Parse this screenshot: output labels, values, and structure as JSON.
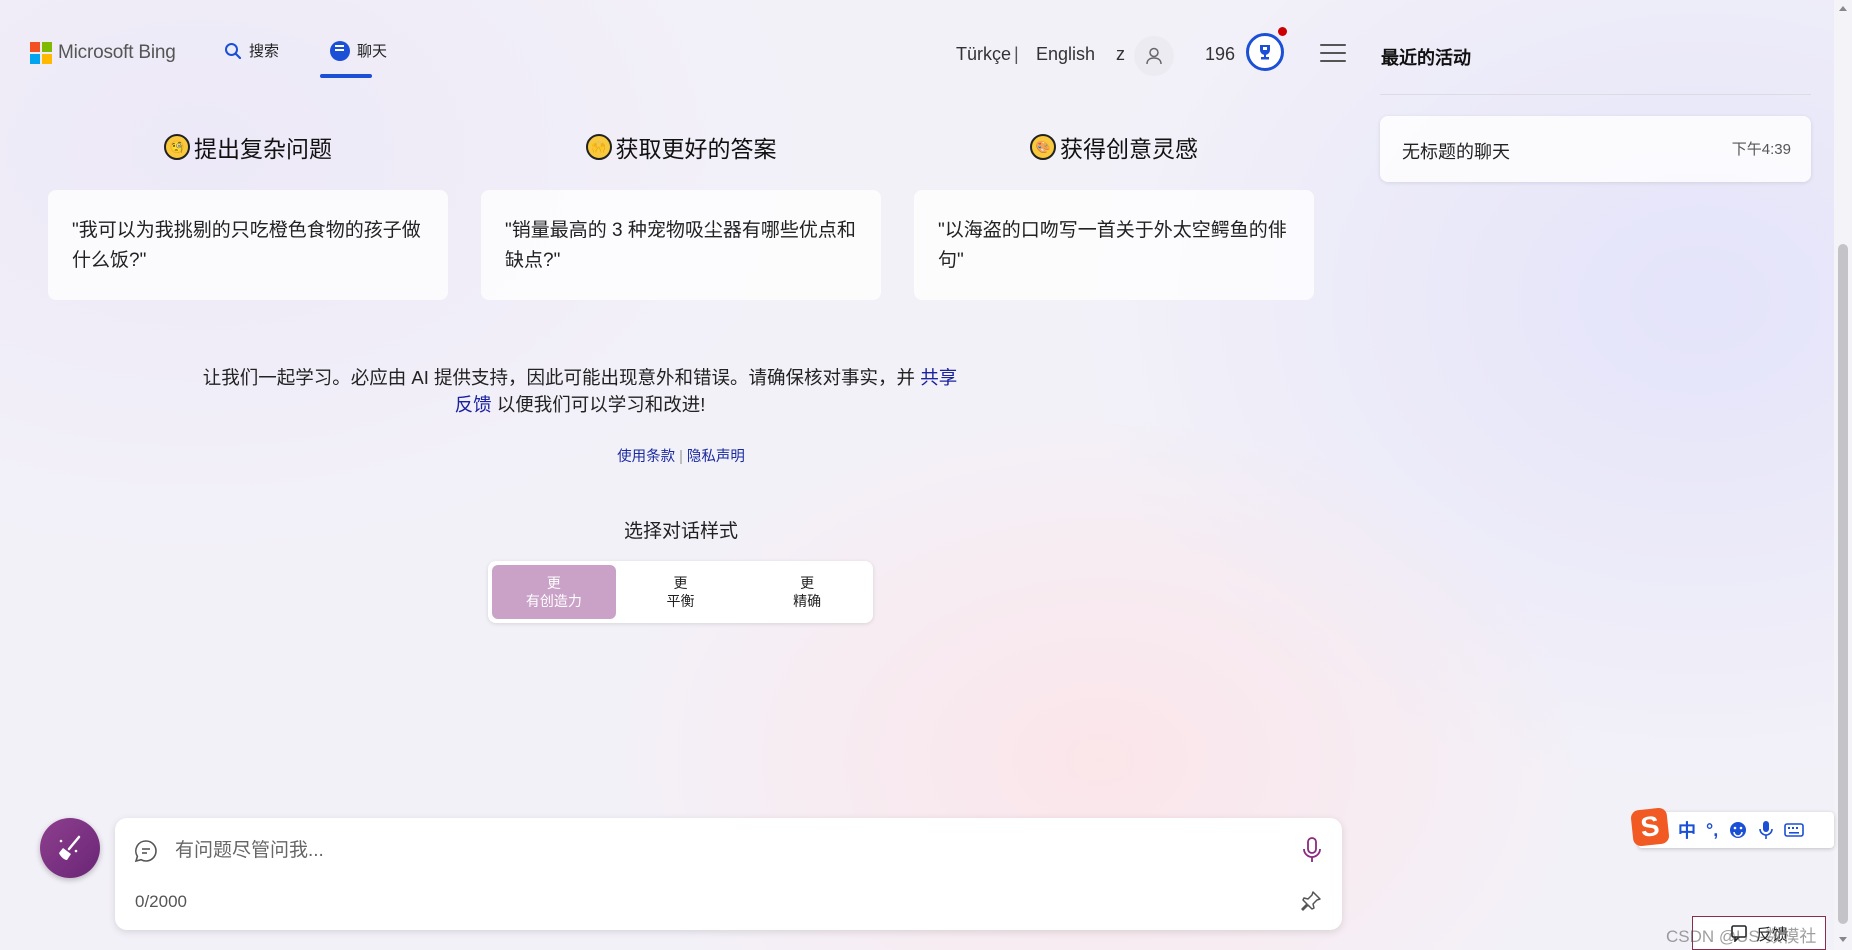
{
  "header": {
    "brand": "Microsoft Bing",
    "nav_search": "搜索",
    "nav_chat": "聊天",
    "lang_1": "Türkçe",
    "lang_sep": "|",
    "lang_2": "English",
    "user_initial": "z",
    "points": "196"
  },
  "main": {
    "categories": [
      {
        "title": "提出复杂问题",
        "example": "\"我可以为我挑剔的只吃橙色食物的孩子做什么饭?\""
      },
      {
        "title": "获取更好的答案",
        "example": "\"销量最高的 3 种宠物吸尘器有哪些优点和缺点?\""
      },
      {
        "title": "获得创意灵感",
        "example": "\"以海盗的口吻写一首关于外太空鳄鱼的俳句\""
      }
    ],
    "disclaimer_text": "让我们一起学习。必应由 AI 提供支持，因此可能出现意外和错误。请确保核对事实，并",
    "disclaimer_link": "共享反馈",
    "disclaimer_tail": "以便我们可以学习和改进!",
    "terms_link": "使用条款",
    "privacy_link": "隐私声明",
    "style_title": "选择对话样式",
    "styles": [
      {
        "top": "更",
        "bottom": "有创造力",
        "active": true
      },
      {
        "top": "更",
        "bottom": "平衡",
        "active": false
      },
      {
        "top": "更",
        "bottom": "精确",
        "active": false
      }
    ]
  },
  "composer": {
    "placeholder": "有问题尽管问我...",
    "char_count": "0/2000"
  },
  "right_panel": {
    "title": "最近的活动",
    "activity_title": "无标题的聊天",
    "activity_time": "下午4:39"
  },
  "ime": {
    "items": [
      "中",
      "°,"
    ]
  },
  "feedback_label": "反馈",
  "watermark": "CSDN @US-数模社",
  "colors": {
    "accent": "#1a4fd6",
    "creative_active": "#caa2c8",
    "broom_button": "#7a3182",
    "link": "#1a22a0"
  }
}
